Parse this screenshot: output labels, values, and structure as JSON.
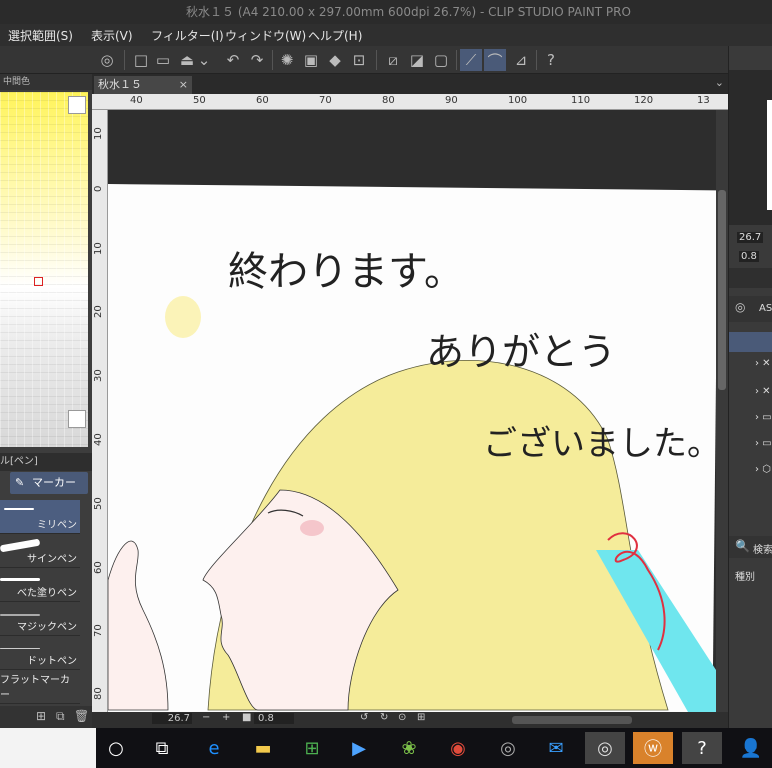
{
  "window": {
    "title": "秋水１５ (A4 210.00 x 297.00mm 600dpi 26.7%)  - CLIP STUDIO PAINT PRO"
  },
  "menu": {
    "items": [
      "選択範囲(S)",
      "表示(V)",
      "フィルター(I)",
      "ウィンドウ(W)",
      "ヘルプ(H)"
    ]
  },
  "color_panel": {
    "header": "中間色"
  },
  "subtool": {
    "header": "ル[ペン]",
    "active_tab": "マーカー",
    "brushes": [
      "ミリペン",
      "サインペン",
      "べた塗りペン",
      "マジックペン",
      "ドットペン",
      "フラットマーカー"
    ],
    "selected_index": 0
  },
  "document": {
    "tab_label": "秋水１５",
    "close_glyph": "×",
    "ruler_top": [
      "40",
      "50",
      "60",
      "70",
      "80",
      "90",
      "100",
      "110",
      "120",
      "13"
    ],
    "ruler_left": [
      "10",
      "0",
      "10",
      "20",
      "30",
      "40",
      "50",
      "60",
      "70",
      "80"
    ],
    "zoom": "26.7",
    "angle": "0.8"
  },
  "artwork": {
    "text_line1": "終わります。",
    "text_line2": "ありがとう",
    "text_line3": "ございました。",
    "hair_color": "#f5ec9a",
    "ribbon_color": "#e03040",
    "ribbon2_color": "#6fe6ee"
  },
  "navigator": {
    "zoom": "26.7",
    "angle": "0.8"
  },
  "material_panel": {
    "label1": "AS",
    "search": "検索",
    "kind": "種別"
  },
  "taskbar": {
    "apps": [
      "start",
      "task-view",
      "edge",
      "explorer",
      "store",
      "media",
      "app-green",
      "chrome",
      "app-disc",
      "mail",
      "clip-studio",
      "wacom",
      "clip-paint",
      "people"
    ]
  }
}
